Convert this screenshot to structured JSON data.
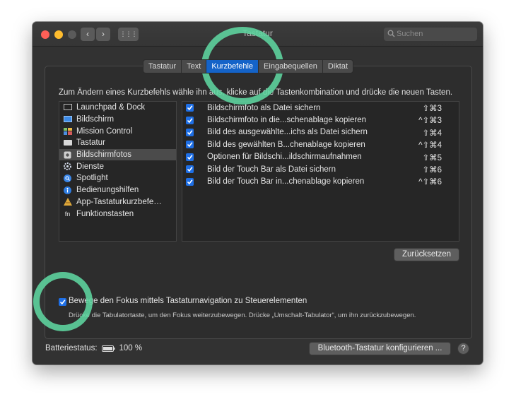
{
  "window": {
    "title": "Tastatur",
    "search_placeholder": "Suchen",
    "back_glyph": "‹",
    "forward_glyph": "›",
    "grid_glyph": "⋮⋮⋮"
  },
  "tabs": [
    {
      "label": "Tastatur"
    },
    {
      "label": "Text"
    },
    {
      "label": "Kurzbefehle",
      "active": true
    },
    {
      "label": "Eingabequellen"
    },
    {
      "label": "Diktat"
    }
  ],
  "instruction": "Zum Ändern eines Kurzbefehls wähle ihn aus, klicke auf die Tastenkombination und drücke die neuen Tasten.",
  "categories": [
    {
      "label": "Launchpad & Dock",
      "icon": "launchpad-icon"
    },
    {
      "label": "Bildschirm",
      "icon": "display-icon"
    },
    {
      "label": "Mission Control",
      "icon": "mission-control-icon"
    },
    {
      "label": "Tastatur",
      "icon": "keyboard-icon"
    },
    {
      "label": "Bildschirmfotos",
      "icon": "screenshot-icon",
      "selected": true
    },
    {
      "label": "Dienste",
      "icon": "gear-icon"
    },
    {
      "label": "Spotlight",
      "icon": "spotlight-icon"
    },
    {
      "label": "Bedienungshilfen",
      "icon": "accessibility-icon"
    },
    {
      "label": "App-Tastaturkurzbefe…",
      "icon": "app-shortcuts-icon"
    },
    {
      "label": "Funktionstasten",
      "icon": "fn-icon",
      "glyph": "fn"
    }
  ],
  "shortcuts": [
    {
      "label": "Bildschirmfoto als Datei sichern",
      "keys": "⇧⌘3",
      "checked": true
    },
    {
      "label": "Bildschirmfoto in die...schenablage kopieren",
      "keys": "^⇧⌘3",
      "checked": true
    },
    {
      "label": "Bild des ausgewählte...ichs als Datei sichern",
      "keys": "⇧⌘4",
      "checked": true
    },
    {
      "label": "Bild des gewählten B...chenablage kopieren",
      "keys": "^⇧⌘4",
      "checked": true
    },
    {
      "label": "Optionen für Bildschi...ildschirmaufnahmen",
      "keys": "⇧⌘5",
      "checked": true
    },
    {
      "label": "Bild der Touch Bar als Datei sichern",
      "keys": "⇧⌘6",
      "checked": true
    },
    {
      "label": "Bild der Touch Bar in...chenablage kopieren",
      "keys": "^⇧⌘6",
      "checked": true
    }
  ],
  "reset_button": "Zurücksetzen",
  "focus_option": {
    "label": "Bewege den Fokus mittels Tastaturnavigation zu Steuerelementen",
    "hint": "Drücke die Tabulatortaste, um den Fokus weiterzubewegen. Drücke „Umschalt-Tabulator“, um ihn zurückzubewegen.",
    "checked": true
  },
  "battery": {
    "label": "Batteriestatus:",
    "value": "100 %"
  },
  "bluetooth_button": "Bluetooth-Tastatur konfigurieren ...",
  "help_glyph": "?",
  "colors": {
    "accent": "#1463c8",
    "checkbox": "#1e6fe6",
    "highlight_ring": "#5ed6a0",
    "window_bg": "#323232"
  }
}
